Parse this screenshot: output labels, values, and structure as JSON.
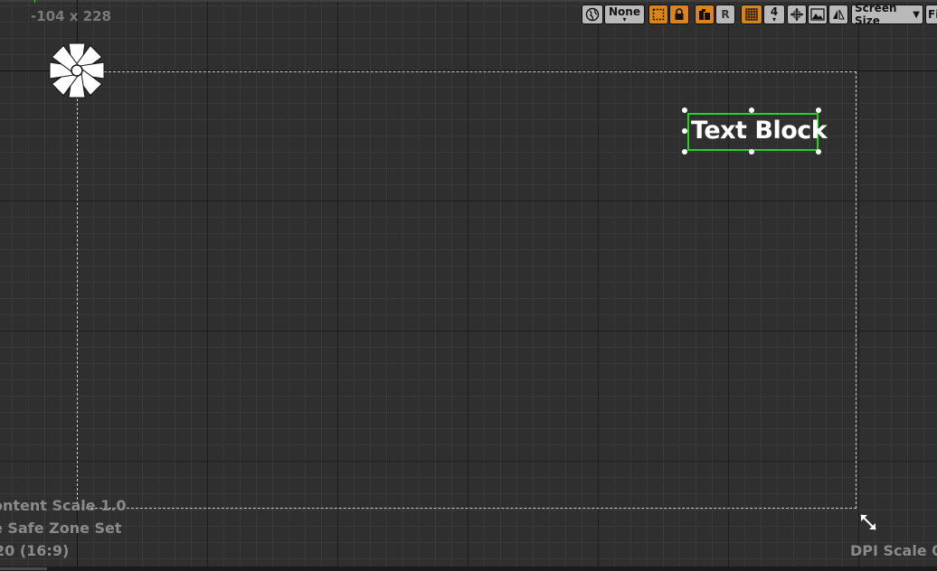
{
  "canvas": {
    "coordinates": "-104 x 228",
    "info_lines": [
      "ontent Scale 1.0",
      "e Safe Zone Set",
      "20 (16:9)"
    ],
    "dpi_scale": "DPI Scale 0"
  },
  "widget": {
    "text": "Text Block",
    "outline_color": "#22d322"
  },
  "toolbar": {
    "world_icon": "globe-icon",
    "transform_mode": "None",
    "reset_label": "R",
    "grid_size": "4",
    "screen_size_label": "Screen Size",
    "fill_label": "Fi",
    "accent_color": "#d9841d"
  }
}
